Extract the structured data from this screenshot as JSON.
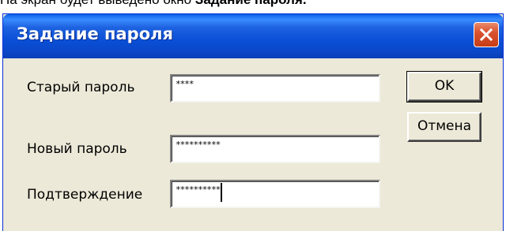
{
  "caption": {
    "prefix": "На экран будет выведено окно ",
    "bold": "Задание пароля."
  },
  "dialog": {
    "title": "Задание пароля",
    "close_icon": "close-x-icon",
    "fields": [
      {
        "label": "Старый пароль",
        "value": "****"
      },
      {
        "label": "Новый пароль",
        "value": "**********"
      },
      {
        "label": "Подтверждение",
        "value": "**********"
      }
    ],
    "ok_label": "OK",
    "cancel_label": "Отмена"
  },
  "colors": {
    "titlebar": "#0a4fd6",
    "dialog_bg": "#ece9d8",
    "close_button": "#d9532f"
  }
}
